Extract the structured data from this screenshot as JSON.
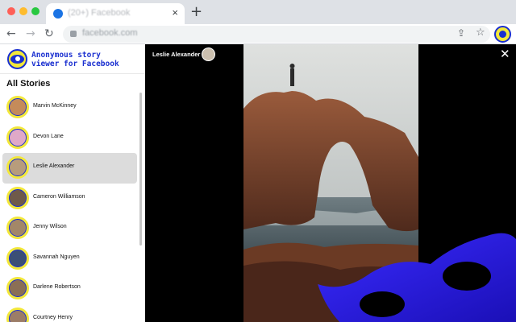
{
  "browser": {
    "tab_title": "(20+) Facebook",
    "url": "facebook.com",
    "new_tab_label": "+",
    "tab_close": "×"
  },
  "brand": {
    "line1": "Anonymous story",
    "line2": "viewer for Facebook",
    "accent": "#1a2fd0",
    "logo_bg": "#f3e83a"
  },
  "sidebar": {
    "title": "All Stories",
    "stories": [
      {
        "name": "Marvin McKinney",
        "active": false,
        "avatar": "#c58b5a"
      },
      {
        "name": "Devon Lane",
        "active": false,
        "avatar": "#e0a9c8"
      },
      {
        "name": "Leslie Alexander",
        "active": true,
        "avatar": "#b79c7c"
      },
      {
        "name": "Cameron Williamson",
        "active": false,
        "avatar": "#6f5a4a"
      },
      {
        "name": "Jenny Wilson",
        "active": false,
        "avatar": "#a38768"
      },
      {
        "name": "Savannah Nguyen",
        "active": false,
        "avatar": "#3c4f75"
      },
      {
        "name": "Darlene Robertson",
        "active": false,
        "avatar": "#8b6f55"
      },
      {
        "name": "Courtney Henry",
        "active": false,
        "avatar": "#9c7d67"
      }
    ]
  },
  "viewer": {
    "user_name": "Leslie Alexander",
    "close_label": "✕"
  }
}
